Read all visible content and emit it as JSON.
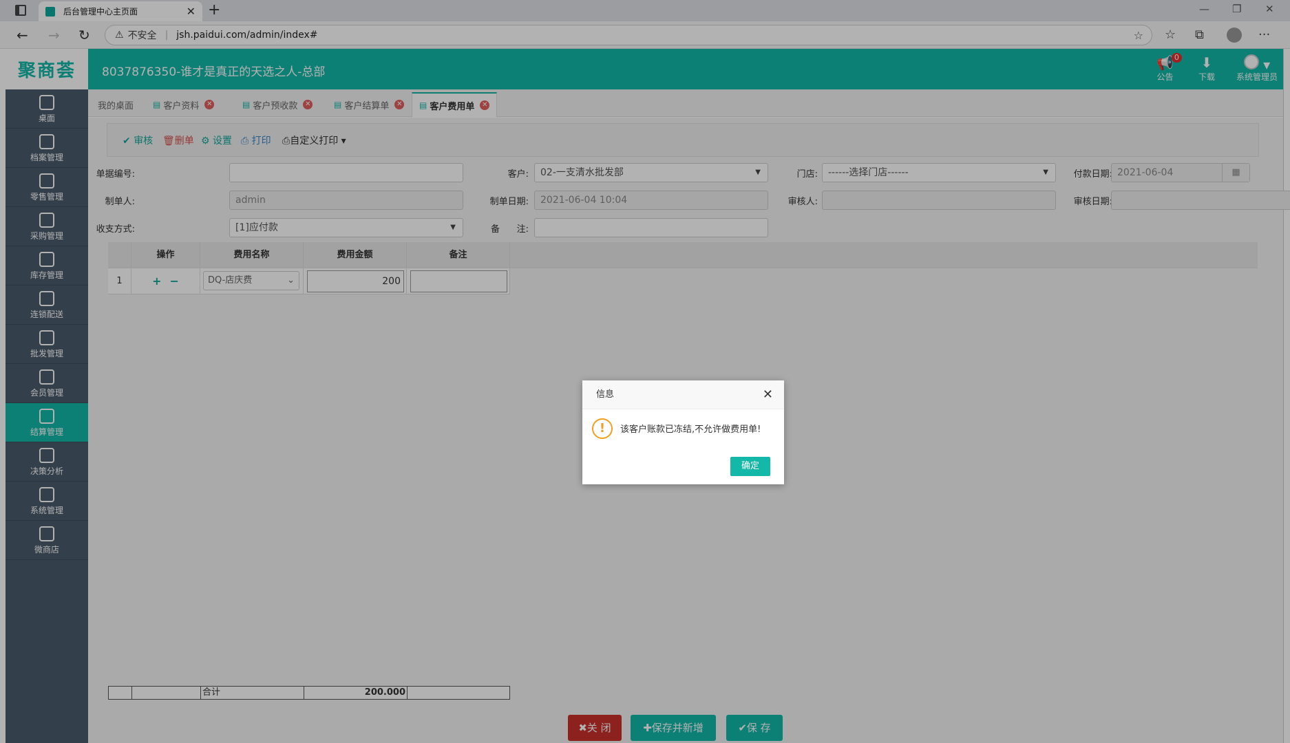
{
  "browser": {
    "tab_title": "后台管理中心主页面",
    "insecure_label": "不安全",
    "url": "jsh.paidui.com/admin/index#"
  },
  "header": {
    "logo": "聚商荟",
    "title": "8037876350-谁才是真正的天选之人-总部",
    "notice_label": "公告",
    "notice_count": "0",
    "download_label": "下载",
    "user_label": "系统管理员"
  },
  "sidebar": {
    "items": [
      {
        "label": "桌面",
        "icon": "dashboard-icon"
      },
      {
        "label": "档案管理",
        "icon": "archive-icon"
      },
      {
        "label": "零售管理",
        "icon": "store-icon"
      },
      {
        "label": "采购管理",
        "icon": "cart-icon"
      },
      {
        "label": "库存管理",
        "icon": "inventory-icon"
      },
      {
        "label": "连锁配送",
        "icon": "truck-icon"
      },
      {
        "label": "批发管理",
        "icon": "wholesale-icon"
      },
      {
        "label": "会员管理",
        "icon": "member-icon"
      },
      {
        "label": "结算管理",
        "icon": "yen-icon"
      },
      {
        "label": "决策分析",
        "icon": "chart-icon"
      },
      {
        "label": "系统管理",
        "icon": "gear-icon"
      },
      {
        "label": "微商店",
        "icon": "shop-bag-icon"
      }
    ]
  },
  "page_tabs": [
    {
      "label": "我的桌面"
    },
    {
      "label": "客户资料"
    },
    {
      "label": "客户预收款"
    },
    {
      "label": "客户结算单"
    },
    {
      "label": "客户费用单"
    }
  ],
  "toolbar": {
    "audit": "审核",
    "delete": "删单",
    "settings": "设置",
    "print": "打印",
    "custom_print": "自定义打印"
  },
  "form": {
    "doc_no_label": "单据编号:",
    "doc_no": "",
    "customer_label": "客户:",
    "customer": "02-一支清水批发部",
    "store_label": "门店:",
    "store": "------选择门店------",
    "pay_date_label": "付款日期:",
    "pay_date": "2021-06-04",
    "creator_label": "制单人:",
    "creator": "admin",
    "create_date_label": "制单日期:",
    "create_date": "2021-06-04 10:04",
    "auditor_label": "审核人:",
    "auditor": "",
    "audit_date_label": "审核日期:",
    "audit_date": "",
    "pay_method_label": "收支方式:",
    "pay_method": "[1]应付款",
    "remark_label_a": "备",
    "remark_label_b": "注:",
    "remark": ""
  },
  "grid": {
    "headers": [
      "操作",
      "费用名称",
      "费用金额",
      "备注"
    ],
    "rows": [
      {
        "index": "1",
        "fee_name": "DQ-店庆费",
        "amount": "200",
        "remark": ""
      }
    ],
    "total_label": "合计",
    "total_amount": "200.000"
  },
  "buttons": {
    "close": "关 闭",
    "save_new": "保存并新增",
    "save": "保 存"
  },
  "modal": {
    "title": "信息",
    "message": "该客户账款已冻结,不允许做费用单!",
    "ok": "确定"
  },
  "colors": {
    "brand": "#14b8a8",
    "sidebar": "#4a5b6a",
    "danger": "#c9302c"
  }
}
